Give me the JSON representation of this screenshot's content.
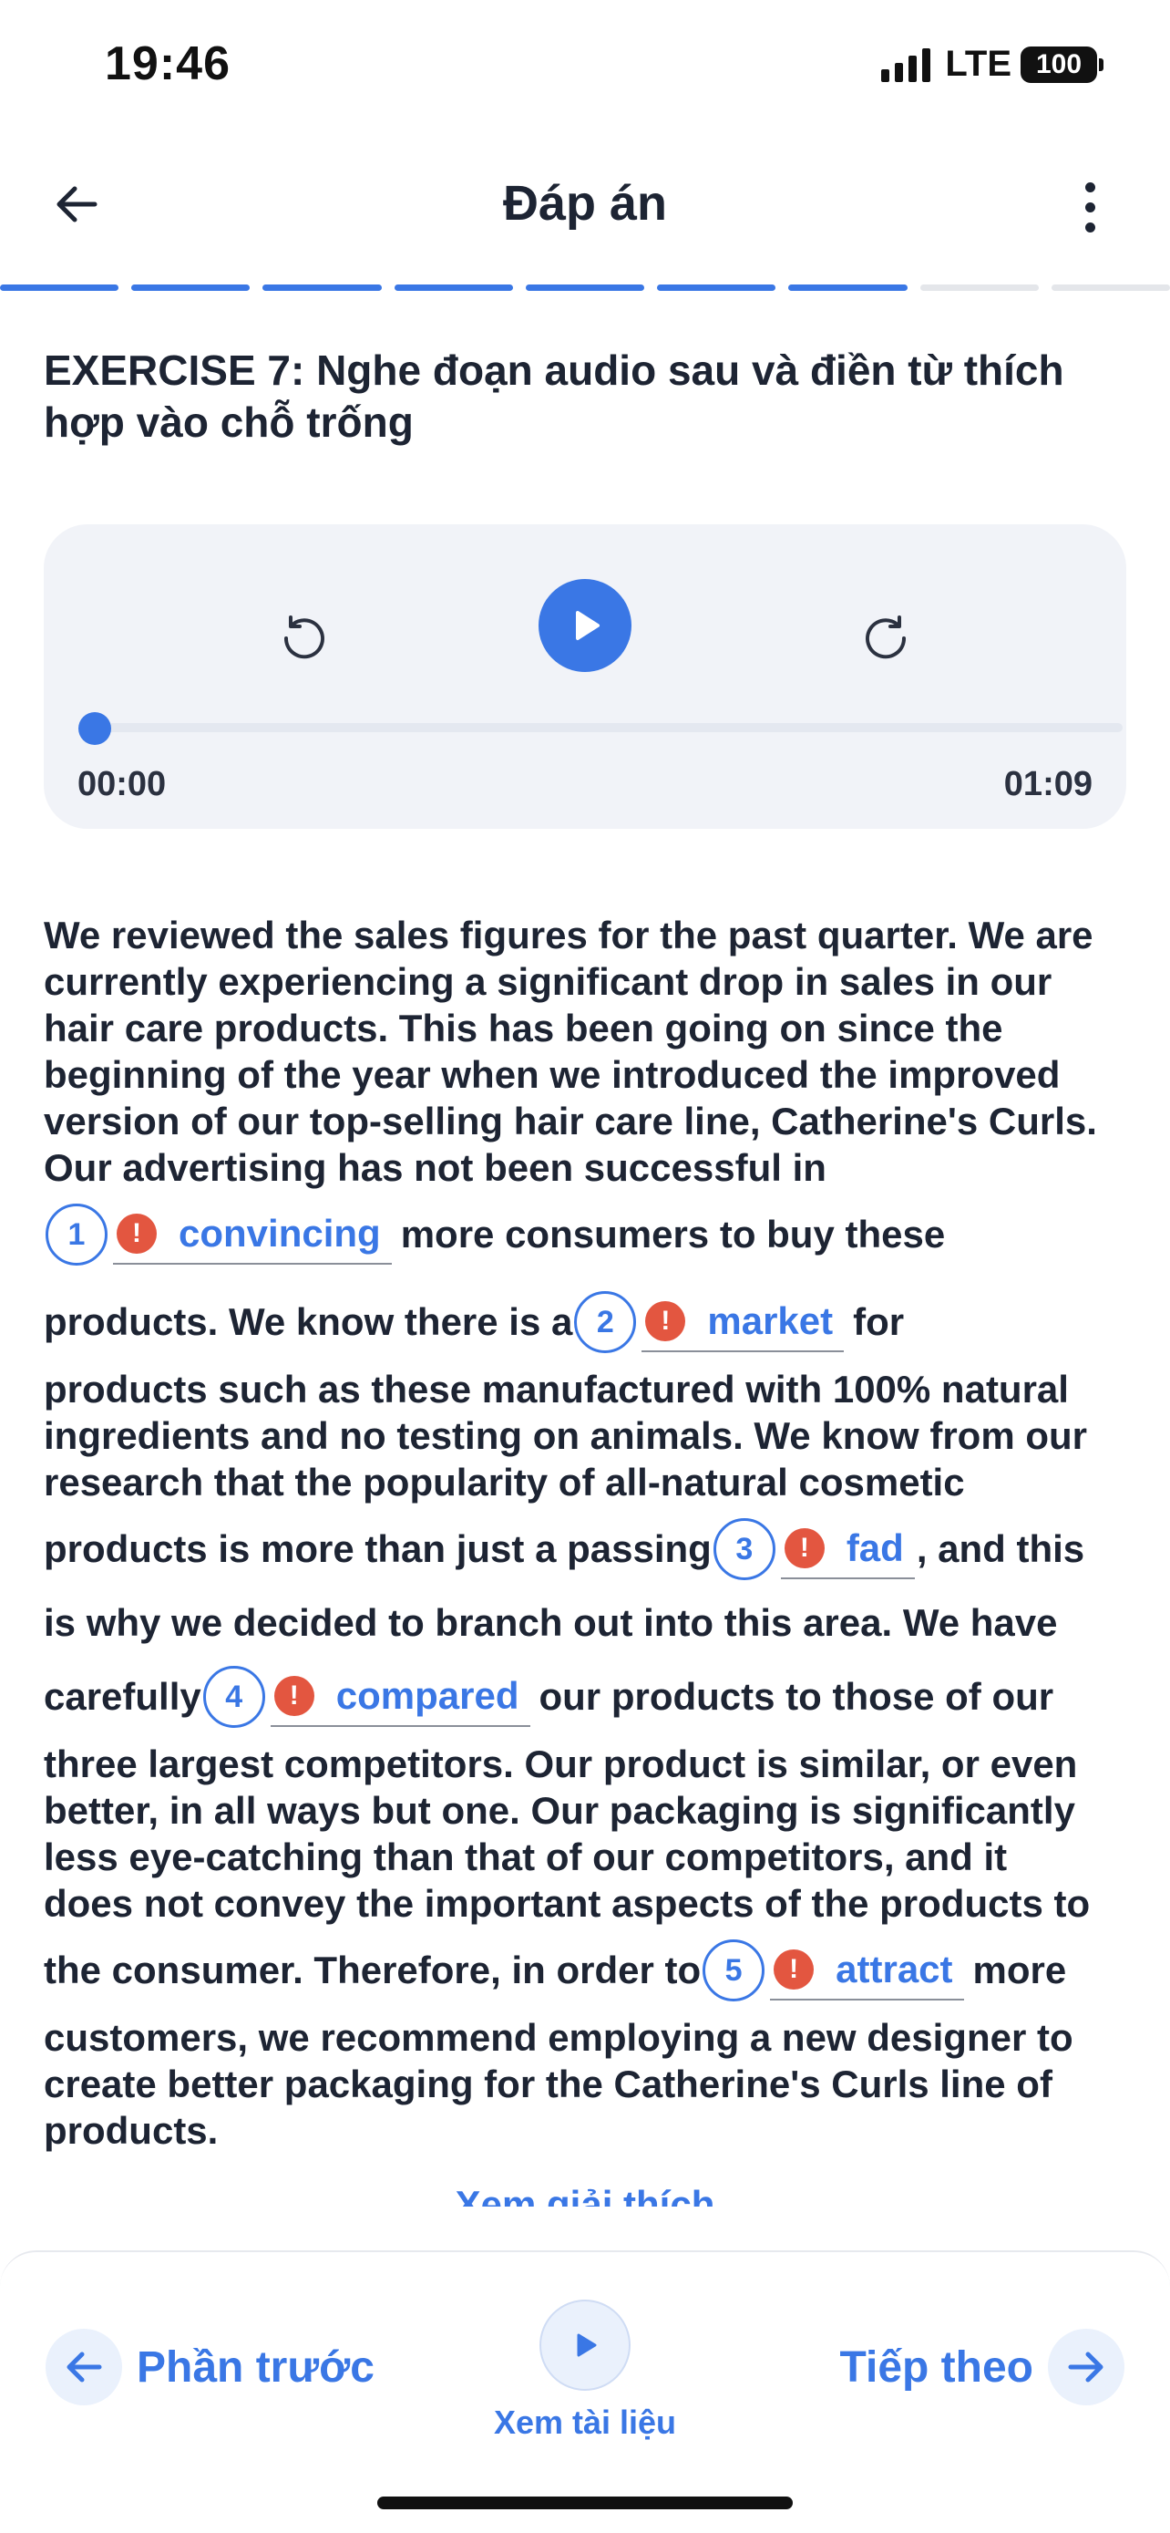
{
  "status_bar": {
    "time": "19:46",
    "network": "LTE",
    "battery": "100"
  },
  "header": {
    "title": "Đáp án",
    "back_icon": "arrow-left-icon",
    "more_icon": "more-vertical-icon"
  },
  "progress": {
    "total_segments": 9,
    "completed_segments": 7
  },
  "exercise": {
    "title": "EXERCISE 7: Nghe đoạn  audio sau và điền từ thích hợp vào chỗ trống"
  },
  "audio": {
    "current_time": "00:00",
    "total_time": "01:09",
    "progress": 0,
    "rewind_icon": "rewind-icon",
    "play_icon": "play-icon",
    "forward_icon": "forward-icon"
  },
  "passage": {
    "lines": [
      "We reviewed the sales figures for the past quarter. We are",
      "currently experiencing a significant drop in sales in our",
      "hair care products. This has been going on since the",
      "beginning of the year when we introduced the improved",
      "version of our top-selling hair care line, Catherine's Curls.",
      "Our advertising has not been successful in",
      "more consumers to buy these",
      "products. We know there is a",
      "for",
      "products such as these manufactured with 100% natural",
      "ingredients and no testing on animals. We know from our",
      "research that the popularity of all-natural cosmetic",
      "products is more than just a passing",
      ", and this",
      "is why we decided to branch out into this area. We have",
      "carefully",
      "our products to those of our",
      "three largest competitors. Our product is similar, or even",
      "better, in all ways but one. Our packaging is significantly",
      "less eye-catching than that of our competitors, and it",
      "does not convey the important aspects of the products to",
      "the consumer. Therefore, in order to",
      "more",
      "customers, we recommend employing a new designer to",
      "create better packaging for the Catherine's Curls line of",
      "products."
    ],
    "blanks": [
      {
        "number": "1",
        "answer": "convincing",
        "status_icon": "!"
      },
      {
        "number": "2",
        "answer": "market",
        "status_icon": "!"
      },
      {
        "number": "3",
        "answer": "fad",
        "status_icon": "!"
      },
      {
        "number": "4",
        "answer": "compared",
        "status_icon": "!"
      },
      {
        "number": "5",
        "answer": "attract",
        "status_icon": "!"
      }
    ]
  },
  "explain_link": "Xem giải thích",
  "bottom_nav": {
    "prev_label": "Phần trước",
    "doc_label": "Xem tài liệu",
    "next_label": "Tiếp theo"
  },
  "colors": {
    "accent": "#3a77e5",
    "error": "#e35640",
    "text": "#1d2433",
    "card_bg": "#f1f3f8"
  }
}
